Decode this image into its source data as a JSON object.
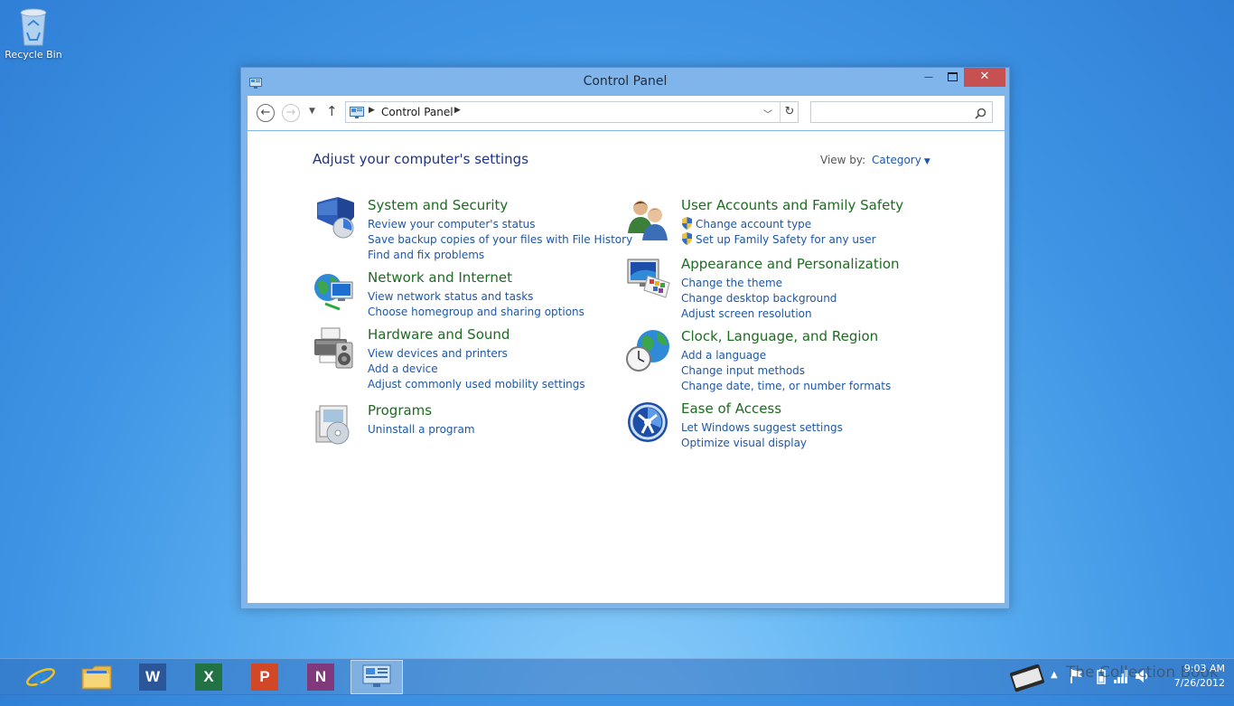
{
  "desktop": {
    "recycle_bin_label": "Recycle Bin"
  },
  "window": {
    "title": "Control Panel",
    "minimize": "—",
    "close": "✕"
  },
  "address": {
    "crumb": "Control Panel",
    "search_placeholder": ""
  },
  "content": {
    "heading": "Adjust your computer's settings",
    "view_by_label": "View by:",
    "view_by_value": "Category"
  },
  "categories": [
    {
      "title": "System and Security",
      "icon": "shield-icon",
      "links": [
        {
          "text": "Review your computer's status",
          "shield": false
        },
        {
          "text": "Save backup copies of your files with File History",
          "shield": false
        },
        {
          "text": "Find and fix problems",
          "shield": false
        }
      ]
    },
    {
      "title": "Network and Internet",
      "icon": "network-globe-icon",
      "links": [
        {
          "text": "View network status and tasks",
          "shield": false
        },
        {
          "text": "Choose homegroup and sharing options",
          "shield": false
        }
      ]
    },
    {
      "title": "Hardware and Sound",
      "icon": "printer-speaker-icon",
      "links": [
        {
          "text": "View devices and printers",
          "shield": false
        },
        {
          "text": "Add a device",
          "shield": false
        },
        {
          "text": "Adjust commonly used mobility settings",
          "shield": false
        }
      ]
    },
    {
      "title": "Programs",
      "icon": "programs-disc-icon",
      "links": [
        {
          "text": "Uninstall a program",
          "shield": false
        }
      ]
    },
    {
      "title": "User Accounts and Family Safety",
      "icon": "users-icon",
      "links": [
        {
          "text": "Change account type",
          "shield": true
        },
        {
          "text": "Set up Family Safety for any user",
          "shield": true
        }
      ]
    },
    {
      "title": "Appearance and Personalization",
      "icon": "monitor-palette-icon",
      "links": [
        {
          "text": "Change the theme",
          "shield": false
        },
        {
          "text": "Change desktop background",
          "shield": false
        },
        {
          "text": "Adjust screen resolution",
          "shield": false
        }
      ]
    },
    {
      "title": "Clock, Language, and Region",
      "icon": "globe-clock-icon",
      "links": [
        {
          "text": "Add a language",
          "shield": false
        },
        {
          "text": "Change input methods",
          "shield": false
        },
        {
          "text": "Change date, time, or number formats",
          "shield": false
        }
      ]
    },
    {
      "title": "Ease of Access",
      "icon": "ease-of-access-icon",
      "links": [
        {
          "text": "Let Windows suggest settings",
          "shield": false
        },
        {
          "text": "Optimize visual display",
          "shield": false
        }
      ]
    }
  ],
  "taskbar": {
    "apps": [
      {
        "name": "internet-explorer",
        "label": "e"
      },
      {
        "name": "file-explorer",
        "label": ""
      },
      {
        "name": "word",
        "label": "W",
        "color": "#2b579a"
      },
      {
        "name": "excel",
        "label": "X",
        "color": "#217346"
      },
      {
        "name": "powerpoint",
        "label": "P",
        "color": "#d24726"
      },
      {
        "name": "onenote",
        "label": "N",
        "color": "#80397b"
      },
      {
        "name": "control-panel",
        "label": ""
      }
    ],
    "time": "9:03 AM",
    "date": "7/26/2012",
    "watermark": "The Collection Book"
  }
}
